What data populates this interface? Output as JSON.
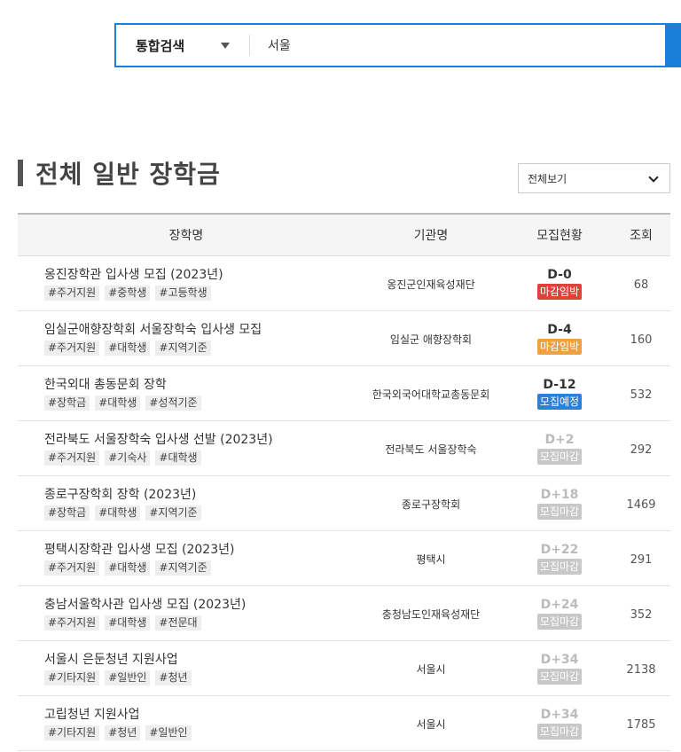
{
  "search": {
    "category": "통합검색",
    "value": "서울"
  },
  "section": {
    "title": "전체 일반 장학금",
    "filter": "전체보기"
  },
  "table": {
    "headers": [
      "장학명",
      "기관명",
      "모집현황",
      "조회"
    ],
    "rows": [
      {
        "name": "옹진장학관 입사생 모집 (2023년)",
        "tags": [
          "#주거지원",
          "#중학생",
          "#고등학생"
        ],
        "org": "옹진군인재육성재단",
        "dday": "D-0",
        "badge": "마감임박",
        "badge_color": "#e0413b",
        "views": "68",
        "past": false
      },
      {
        "name": "임실군애향장학회 서울장학숙 입사생 모집",
        "tags": [
          "#주거지원",
          "#대학생",
          "#지역기준"
        ],
        "org": "임실군 애향장학회",
        "dday": "D-4",
        "badge": "마감임박",
        "badge_color": "#f0a040",
        "views": "160",
        "past": false
      },
      {
        "name": "한국외대 총동문회 장학",
        "tags": [
          "#장학금",
          "#대학생",
          "#성적기준"
        ],
        "org": "한국외국어대학교총동문회",
        "dday": "D-12",
        "badge": "모집예정",
        "badge_color": "#2e7fd6",
        "views": "532",
        "past": false
      },
      {
        "name": "전라북도 서울장학숙 입사생 선발 (2023년)",
        "tags": [
          "#주거지원",
          "#기숙사",
          "#대학생"
        ],
        "org": "전라북도 서울장학숙",
        "dday": "D+2",
        "badge": "모집마감",
        "badge_color": "#c8c8c8",
        "views": "292",
        "past": true
      },
      {
        "name": "종로구장학회 장학 (2023년)",
        "tags": [
          "#장학금",
          "#대학생",
          "#지역기준"
        ],
        "org": "종로구장학회",
        "dday": "D+18",
        "badge": "모집마감",
        "badge_color": "#c8c8c8",
        "views": "1469",
        "past": true
      },
      {
        "name": "평택시장학관 입사생 모집 (2023년)",
        "tags": [
          "#주거지원",
          "#대학생",
          "#지역기준"
        ],
        "org": "평택시",
        "dday": "D+22",
        "badge": "모집마감",
        "badge_color": "#c8c8c8",
        "views": "291",
        "past": true
      },
      {
        "name": "충남서울학사관 입사생 모집 (2023년)",
        "tags": [
          "#주거지원",
          "#대학생",
          "#전문대"
        ],
        "org": "충청남도인재육성재단",
        "dday": "D+24",
        "badge": "모집마감",
        "badge_color": "#c8c8c8",
        "views": "352",
        "past": true
      },
      {
        "name": "서울시 은둔청년 지원사업",
        "tags": [
          "#기타지원",
          "#일반인",
          "#청년"
        ],
        "org": "서울시",
        "dday": "D+34",
        "badge": "모집마감",
        "badge_color": "#c8c8c8",
        "views": "2138",
        "past": true
      },
      {
        "name": "고립청년 지원사업",
        "tags": [
          "#기타지원",
          "#청년",
          "#일반인"
        ],
        "org": "서울시",
        "dday": "D+34",
        "badge": "모집마감",
        "badge_color": "#c8c8c8",
        "views": "1785",
        "past": true
      }
    ]
  }
}
